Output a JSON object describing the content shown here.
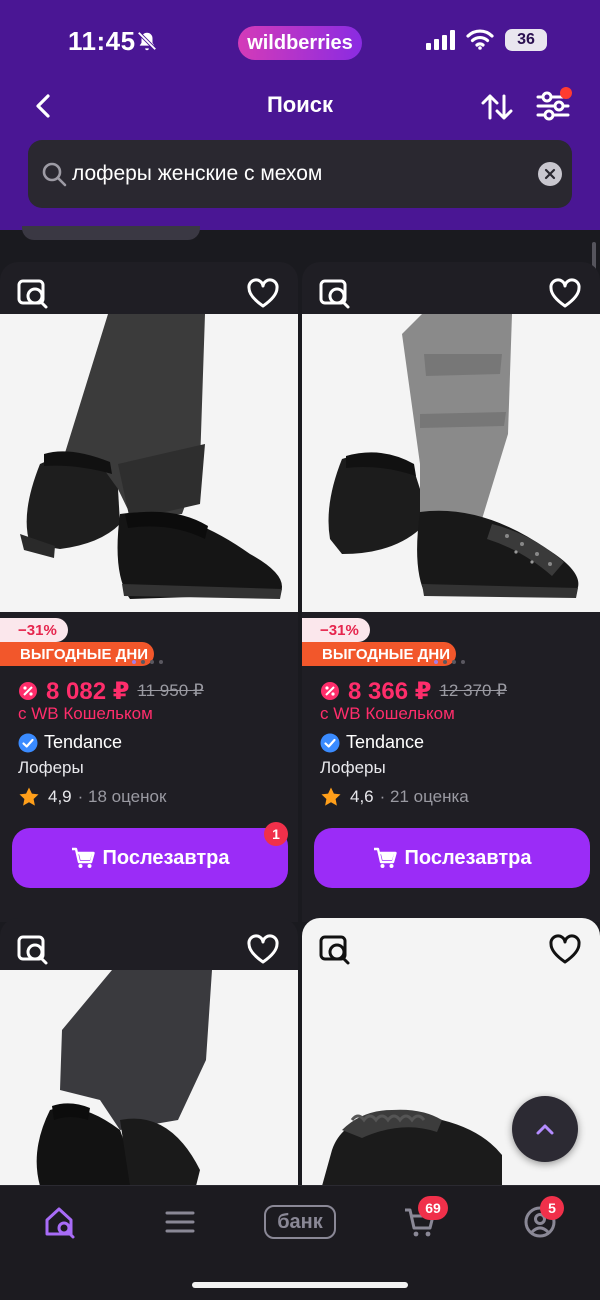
{
  "status_bar": {
    "time": "11:45",
    "brand": "wildberries",
    "battery": "36",
    "icons": [
      "bell-off-icon",
      "cellular-signal-icon",
      "wifi-icon",
      "battery-icon"
    ]
  },
  "nav": {
    "title": "Поиск",
    "icons": [
      "back-arrow-icon",
      "sort-icon",
      "filter-icon"
    ]
  },
  "search": {
    "value": "лоферы женские с мехом"
  },
  "colors": {
    "header": "#4a1694",
    "price": "#ff2d6b",
    "button": "#9b2cf7",
    "promo": "#f2572b"
  },
  "products": [
    {
      "discount": "−31%",
      "promo": "ВЫГОДНЫЕ ДНИ",
      "price": "8 082 ₽",
      "old_price": "11 950 ₽",
      "wallet_text": "с WB Кошельком",
      "brand": "Tendance",
      "name": "Лоферы",
      "rating": "4,9",
      "reviews": "· 18 оценок",
      "button": "Послезавтра",
      "cart_count": "1"
    },
    {
      "discount": "−31%",
      "promo": "ВЫГОДНЫЕ ДНИ",
      "price": "8 366 ₽",
      "old_price": "12 370 ₽",
      "wallet_text": "с WB Кошельком",
      "brand": "Tendance",
      "name": "Лоферы",
      "rating": "4,6",
      "reviews": "· 21 оценка",
      "button": "Послезавтра"
    }
  ],
  "tabbar": {
    "bank_label": "банк",
    "cart_badge": "69",
    "profile_badge": "5",
    "icons": [
      "home-search-icon",
      "menu-icon",
      "bank-icon",
      "cart-icon",
      "profile-icon"
    ]
  }
}
